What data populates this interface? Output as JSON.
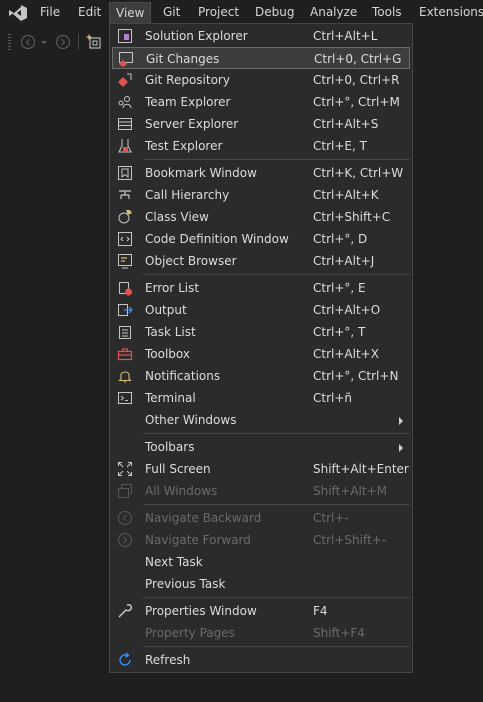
{
  "menubar": {
    "items": [
      "File",
      "Edit",
      "View",
      "Git",
      "Project",
      "Debug",
      "Analyze",
      "Tools",
      "Extensions"
    ]
  },
  "view_menu": {
    "items": [
      {
        "label": "Solution Explorer",
        "shortcut": "Ctrl+Alt+L",
        "icon": "solution-explorer-icon"
      },
      {
        "label": "Git Changes",
        "shortcut": "Ctrl+0, Ctrl+G",
        "icon": "git-changes-icon",
        "highlighted": true
      },
      {
        "label": "Git Repository",
        "shortcut": "Ctrl+0, Ctrl+R",
        "icon": "git-repository-icon"
      },
      {
        "label": "Team Explorer",
        "shortcut": "Ctrl+°, Ctrl+M",
        "icon": "team-explorer-icon"
      },
      {
        "label": "Server Explorer",
        "shortcut": "Ctrl+Alt+S",
        "icon": "server-explorer-icon"
      },
      {
        "label": "Test Explorer",
        "shortcut": "Ctrl+E, T",
        "icon": "test-explorer-icon"
      },
      {
        "label": "Bookmark Window",
        "shortcut": "Ctrl+K, Ctrl+W",
        "icon": "bookmark-icon"
      },
      {
        "label": "Call Hierarchy",
        "shortcut": "Ctrl+Alt+K",
        "icon": "call-hierarchy-icon"
      },
      {
        "label": "Class View",
        "shortcut": "Ctrl+Shift+C",
        "icon": "class-view-icon"
      },
      {
        "label": "Code Definition Window",
        "shortcut": "Ctrl+°, D",
        "icon": "code-definition-icon"
      },
      {
        "label": "Object Browser",
        "shortcut": "Ctrl+Alt+J",
        "icon": "object-browser-icon"
      },
      {
        "label": "Error List",
        "shortcut": "Ctrl+°, E",
        "icon": "error-list-icon"
      },
      {
        "label": "Output",
        "shortcut": "Ctrl+Alt+O",
        "icon": "output-icon"
      },
      {
        "label": "Task List",
        "shortcut": "Ctrl+°, T",
        "icon": "task-list-icon"
      },
      {
        "label": "Toolbox",
        "shortcut": "Ctrl+Alt+X",
        "icon": "toolbox-icon"
      },
      {
        "label": "Notifications",
        "shortcut": "Ctrl+°, Ctrl+N",
        "icon": "bell-icon"
      },
      {
        "label": "Terminal",
        "shortcut": "Ctrl+ñ",
        "icon": "terminal-icon"
      },
      {
        "label": "Other Windows",
        "shortcut": "",
        "submenu": true
      },
      {
        "label": "Toolbars",
        "shortcut": "",
        "submenu": true
      },
      {
        "label": "Full Screen",
        "shortcut": "Shift+Alt+Enter",
        "icon": "full-screen-icon"
      },
      {
        "label": "All Windows",
        "shortcut": "Shift+Alt+M",
        "icon": "all-windows-icon",
        "disabled": true
      },
      {
        "label": "Navigate Backward",
        "shortcut": "Ctrl+-",
        "icon": "navigate-back-icon",
        "disabled": true
      },
      {
        "label": "Navigate Forward",
        "shortcut": "Ctrl+Shift+-",
        "icon": "navigate-forward-icon",
        "disabled": true
      },
      {
        "label": "Next Task",
        "shortcut": ""
      },
      {
        "label": "Previous Task",
        "shortcut": ""
      },
      {
        "label": "Properties Window",
        "shortcut": "F4",
        "icon": "wrench-icon"
      },
      {
        "label": "Property Pages",
        "shortcut": "Shift+F4",
        "disabled": true
      },
      {
        "label": "Refresh",
        "shortcut": "",
        "icon": "refresh-icon"
      }
    ]
  },
  "colors": {
    "background": "#1f1f1f",
    "menu_background": "#2b2b2b",
    "highlight": "#3d3d3d",
    "accent_purple": "#b180d7",
    "accent_red": "#e05252",
    "accent_blue": "#3794ff"
  }
}
